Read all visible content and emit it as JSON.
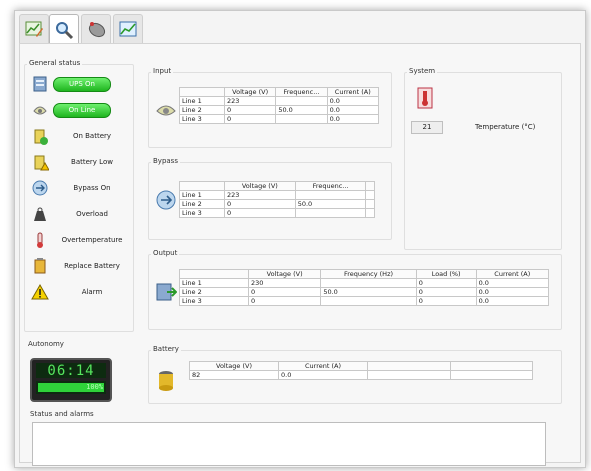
{
  "general_status": {
    "title": "General status",
    "items": [
      {
        "label": "UPS On",
        "style": "pill",
        "icon": "ups-server-icon"
      },
      {
        "label": "On Line",
        "style": "pill",
        "icon": "power-plug-icon"
      },
      {
        "label": "On Battery",
        "style": "text",
        "icon": "battery-check-icon"
      },
      {
        "label": "Battery Low",
        "style": "text",
        "icon": "battery-warning-icon"
      },
      {
        "label": "Bypass On",
        "style": "text",
        "icon": "bypass-icon"
      },
      {
        "label": "Overload",
        "style": "text",
        "icon": "weight-icon"
      },
      {
        "label": "Overtemperature",
        "style": "text",
        "icon": "thermometer-icon"
      },
      {
        "label": "Replace Battery",
        "style": "text",
        "icon": "battery-replace-icon"
      },
      {
        "label": "Alarm",
        "style": "text",
        "icon": "alarm-triangle-icon"
      }
    ]
  },
  "input": {
    "title": "Input",
    "headers": [
      "",
      "Voltage (V)",
      "Frequenc...",
      "Current (A)"
    ],
    "rows": [
      [
        "Line 1",
        "223",
        "",
        "0.0"
      ],
      [
        "Line 2",
        "0",
        "50.0",
        "0.0"
      ],
      [
        "Line 3",
        "0",
        "",
        "0.0"
      ]
    ]
  },
  "system": {
    "title": "System",
    "temperature_value": "21",
    "temperature_label": "Temperature (°C)"
  },
  "bypass": {
    "title": "Bypass",
    "headers": [
      "",
      "Voltage (V)",
      "Frequenc...",
      ""
    ],
    "rows": [
      [
        "Line 1",
        "223",
        "",
        ""
      ],
      [
        "Line 2",
        "0",
        "50.0",
        ""
      ],
      [
        "Line 3",
        "0",
        "",
        ""
      ]
    ]
  },
  "output": {
    "title": "Output",
    "headers": [
      "",
      "Voltage (V)",
      "Frequency (Hz)",
      "Load (%)",
      "Current (A)"
    ],
    "rows": [
      [
        "Line 1",
        "230",
        "",
        "0",
        "0.0"
      ],
      [
        "Line 2",
        "0",
        "50.0",
        "0",
        "0.0"
      ],
      [
        "Line 3",
        "0",
        "",
        "0",
        "0.0"
      ]
    ]
  },
  "autonomy": {
    "title": "Autonomy",
    "time": "06:14",
    "charge_percent": 100,
    "charge_label": "100%"
  },
  "battery": {
    "title": "Battery",
    "headers": [
      "Voltage (V)",
      "Current (A)",
      "",
      ""
    ],
    "rows": [
      [
        "82",
        "0.0",
        "",
        ""
      ]
    ]
  },
  "status_alarms": {
    "title": "Status and alarms",
    "text": ""
  },
  "tabs": [
    {
      "icon": "edit-chart-icon"
    },
    {
      "icon": "magnifier-icon"
    },
    {
      "icon": "mouse-icon"
    },
    {
      "icon": "graph-icon"
    }
  ],
  "colors": {
    "pill_green": "#2fc12f",
    "lcd_green": "#56e45e"
  }
}
